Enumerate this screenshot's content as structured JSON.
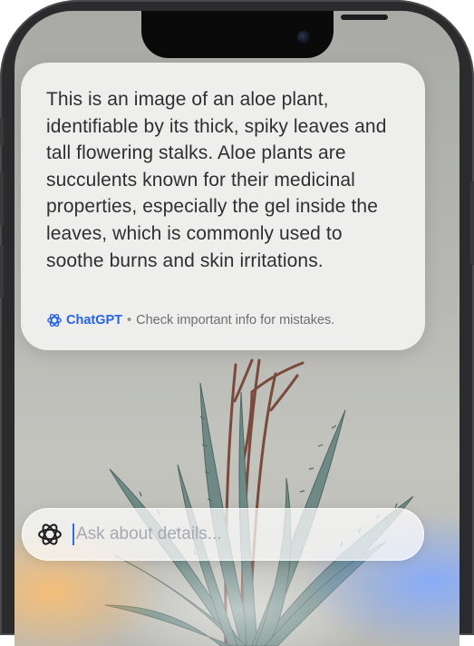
{
  "card": {
    "text": "This is an image of an aloe plant, identifiable by its thick, spiky leaves and tall flowering stalks. Aloe plants are succulents known for their medicinal properties, especially the gel inside the leaves, which is commonly used to soothe burns and skin irritations.",
    "brand": "ChatGPT",
    "separator": "•",
    "disclaimer": "Check important info for mistakes."
  },
  "ask": {
    "placeholder": "Ask about details..."
  },
  "icons": {
    "brand": "chatgpt-logo-icon",
    "ask": "chatgpt-logo-icon",
    "camera": "front-camera-icon"
  },
  "colors": {
    "brand": "#2563eb",
    "caret": "#2d6cf0"
  }
}
